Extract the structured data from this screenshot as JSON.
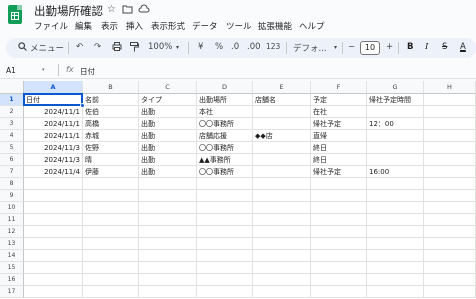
{
  "app": {
    "title": "出勤場所確認",
    "icons": [
      "star-icon",
      "folder-icon",
      "cloud-icon"
    ]
  },
  "menu": [
    "ファイル",
    "編集",
    "表示",
    "挿入",
    "表示形式",
    "データ",
    "ツール",
    "拡張機能",
    "ヘルプ"
  ],
  "toolbar": {
    "search_label": "メニュー",
    "zoom": "100%",
    "currency": "¥",
    "percent": "%",
    "dec_decrease": ".0",
    "dec_increase": ".00",
    "number_format": "123",
    "font": "デフォ...",
    "font_size": "10",
    "minus": "−",
    "plus": "+",
    "bold": "B",
    "italic": "I",
    "strike": "S",
    "text_color": "A"
  },
  "formula_bar": {
    "cell_ref": "A1",
    "fx": "fx",
    "value": "日付"
  },
  "sheet": {
    "columns": [
      "A",
      "B",
      "C",
      "D",
      "E",
      "F",
      "G",
      "H"
    ],
    "rows": [
      [
        "日付",
        "名前",
        "タイプ",
        "出勤場所",
        "店舗名",
        "予定",
        "帰社予定時間",
        ""
      ],
      [
        "2024/11/1",
        "佐伯",
        "出勤",
        "本社",
        "",
        "在社",
        "",
        ""
      ],
      [
        "2024/11/1",
        "高橋",
        "出勤",
        "〇〇事務所",
        "",
        "帰社予定",
        "12：00",
        ""
      ],
      [
        "2024/11/1",
        "赤城",
        "出勤",
        "店舗応援",
        "◆◆店",
        "直帰",
        "",
        ""
      ],
      [
        "2024/11/3",
        "佐野",
        "出勤",
        "〇〇事務所",
        "",
        "終日",
        "",
        ""
      ],
      [
        "2024/11/3",
        "晴",
        "出勤",
        "▲▲事務所",
        "",
        "終日",
        "",
        ""
      ],
      [
        "2024/11/4",
        "伊藤",
        "出勤",
        "〇〇事務所",
        "",
        "帰社予定",
        "16:00",
        ""
      ]
    ],
    "row_numbers": [
      "1",
      "2",
      "3",
      "4",
      "5",
      "6",
      "7",
      "8",
      "9",
      "10",
      "11",
      "12",
      "13",
      "14",
      "15",
      "16",
      "17"
    ]
  }
}
